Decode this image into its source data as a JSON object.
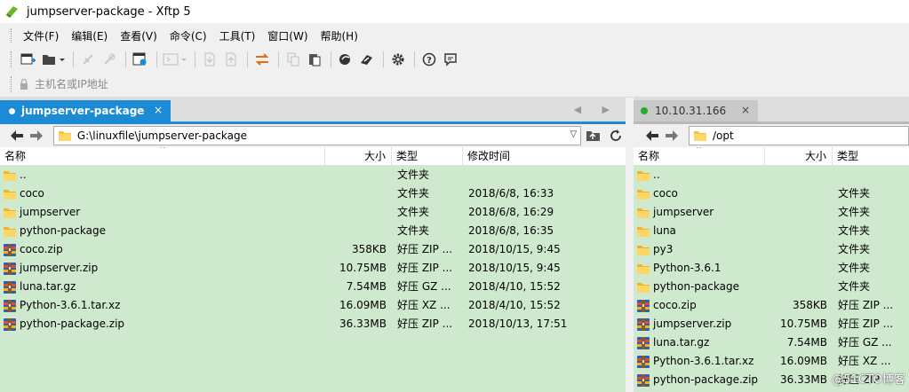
{
  "window": {
    "title": "jumpserver-package - Xftp 5"
  },
  "menu": [
    "文件(F)",
    "编辑(E)",
    "查看(V)",
    "命令(C)",
    "工具(T)",
    "窗口(W)",
    "帮助(H)"
  ],
  "address": {
    "placeholder": "主机名或IP地址"
  },
  "left_tab": {
    "label": "jumpserver-package",
    "close": "×",
    "nav": "◀ ▶"
  },
  "right_tab": {
    "label": "10.10.31.166",
    "close": "×"
  },
  "left_path": "G:\\linuxfile\\jumpserver-package",
  "right_path": "/opt",
  "columns": {
    "name": "名称",
    "size": "大小",
    "type": "类型",
    "modified": "修改时间"
  },
  "left_files": [
    {
      "name": "..",
      "size": "",
      "type": "文件夹",
      "modified": "",
      "icon": "folder-icon"
    },
    {
      "name": "coco",
      "size": "",
      "type": "文件夹",
      "modified": "2018/6/8, 16:33",
      "icon": "folder-icon"
    },
    {
      "name": "jumpserver",
      "size": "",
      "type": "文件夹",
      "modified": "2018/6/8, 16:29",
      "icon": "folder-icon"
    },
    {
      "name": "python-package",
      "size": "",
      "type": "文件夹",
      "modified": "2018/6/8, 16:35",
      "icon": "folder-icon"
    },
    {
      "name": "coco.zip",
      "size": "358KB",
      "type": "好压 ZIP ...",
      "modified": "2018/10/15, 9:45",
      "icon": "archive-icon"
    },
    {
      "name": "jumpserver.zip",
      "size": "10.75MB",
      "type": "好压 ZIP ...",
      "modified": "2018/10/15, 9:45",
      "icon": "archive-icon"
    },
    {
      "name": "luna.tar.gz",
      "size": "7.54MB",
      "type": "好压 GZ ...",
      "modified": "2018/4/10, 15:52",
      "icon": "archive-icon"
    },
    {
      "name": "Python-3.6.1.tar.xz",
      "size": "16.09MB",
      "type": "好压 XZ ...",
      "modified": "2018/4/10, 15:52",
      "icon": "archive-icon"
    },
    {
      "name": "python-package.zip",
      "size": "36.33MB",
      "type": "好压 ZIP ...",
      "modified": "2018/10/13, 17:51",
      "icon": "archive-icon"
    }
  ],
  "right_files": [
    {
      "name": "..",
      "size": "",
      "type": "",
      "icon": "folder-icon"
    },
    {
      "name": "coco",
      "size": "",
      "type": "文件夹",
      "icon": "folder-icon"
    },
    {
      "name": "jumpserver",
      "size": "",
      "type": "文件夹",
      "icon": "folder-icon"
    },
    {
      "name": "luna",
      "size": "",
      "type": "文件夹",
      "icon": "folder-icon"
    },
    {
      "name": "py3",
      "size": "",
      "type": "文件夹",
      "icon": "folder-icon"
    },
    {
      "name": "Python-3.6.1",
      "size": "",
      "type": "文件夹",
      "icon": "folder-icon"
    },
    {
      "name": "python-package",
      "size": "",
      "type": "文件夹",
      "icon": "folder-icon"
    },
    {
      "name": "coco.zip",
      "size": "358KB",
      "type": "好压 ZIP ...",
      "icon": "archive-icon"
    },
    {
      "name": "jumpserver.zip",
      "size": "10.75MB",
      "type": "好压 ZIP ...",
      "icon": "archive-icon"
    },
    {
      "name": "luna.tar.gz",
      "size": "7.54MB",
      "type": "好压 GZ ...",
      "icon": "archive-icon"
    },
    {
      "name": "Python-3.6.1.tar.xz",
      "size": "16.09MB",
      "type": "好压 XZ ...",
      "icon": "archive-icon"
    },
    {
      "name": "python-package.zip",
      "size": "36.33MB",
      "type": "好压 ZIP ...",
      "icon": "archive-icon"
    }
  ],
  "watermark": "@51CTO博客",
  "colors": {
    "accent": "#1c8bd6",
    "list_bg": "#cfe9cf",
    "connected": "#1fae2f"
  }
}
